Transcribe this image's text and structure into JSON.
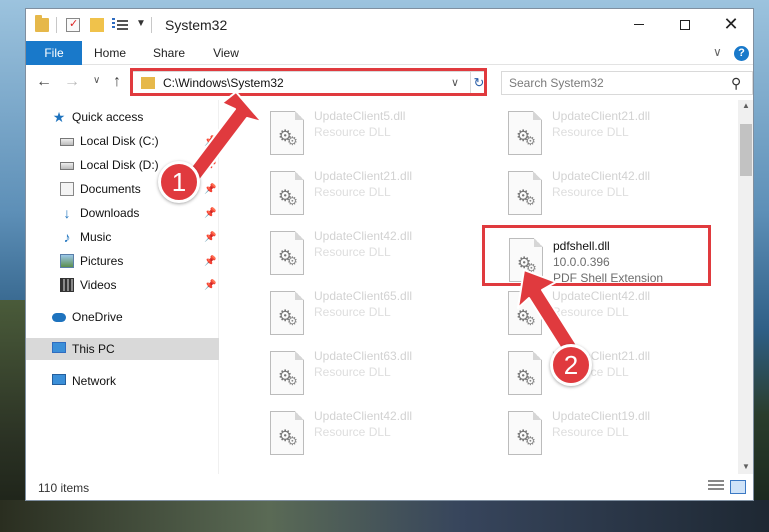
{
  "window": {
    "title": "System32",
    "minimize_icon": "minimize-icon",
    "maximize_icon": "maximize-icon",
    "close_label": "✕"
  },
  "ribbon": {
    "tabs": [
      {
        "label": "File"
      },
      {
        "label": "Home"
      },
      {
        "label": "Share"
      },
      {
        "label": "View"
      }
    ],
    "help_label": "?"
  },
  "nav": {
    "address": "C:\\Windows\\System32",
    "search_placeholder": "Search System32"
  },
  "sidebar": {
    "items": [
      {
        "label": "Quick access",
        "icon": "star-icon"
      },
      {
        "label": "Local Disk (C:)",
        "icon": "drive-icon"
      },
      {
        "label": "Local Disk (D:)",
        "icon": "drive-icon"
      },
      {
        "label": "Documents",
        "icon": "documents-icon"
      },
      {
        "label": "Downloads",
        "icon": "downloads-icon"
      },
      {
        "label": "Music",
        "icon": "music-icon"
      },
      {
        "label": "Pictures",
        "icon": "pictures-icon"
      },
      {
        "label": "Videos",
        "icon": "videos-icon"
      },
      {
        "label": "OneDrive",
        "icon": "cloud-icon"
      },
      {
        "label": "This PC",
        "icon": "computer-icon"
      },
      {
        "label": "Network",
        "icon": "network-icon"
      }
    ]
  },
  "files": {
    "left": [
      {
        "name": "UpdateClient5.dll",
        "desc": "Resource DLL"
      },
      {
        "name": "UpdateClient21.dll",
        "desc": "Resource DLL"
      },
      {
        "name": "UpdateClient42.dll",
        "desc": "Resource DLL"
      },
      {
        "name": "UpdateClient65.dll",
        "desc": "Resource DLL"
      },
      {
        "name": "UpdateClient63.dll",
        "desc": "Resource DLL"
      },
      {
        "name": "UpdateClient42.dll",
        "desc": "Resource DLL"
      }
    ],
    "right": [
      {
        "name": "UpdateClient21.dll",
        "desc": "Resource DLL"
      },
      {
        "name": "UpdateClient42.dll",
        "desc": "Resource DLL"
      },
      {
        "name": "pdfshell.dll",
        "version": "10.0.0.396",
        "desc": "PDF Shell Extension"
      },
      {
        "name": "UpdateClient42.dll",
        "desc": "Resource DLL"
      },
      {
        "name": "UpdateClient21.dll",
        "desc": "Resource DLL"
      },
      {
        "name": "UpdateClient19.dll",
        "desc": "Resource DLL"
      }
    ]
  },
  "status": {
    "item_count": "110 items"
  },
  "annotations": {
    "step1": "1",
    "step2": "2",
    "color": "#e03a3e"
  }
}
